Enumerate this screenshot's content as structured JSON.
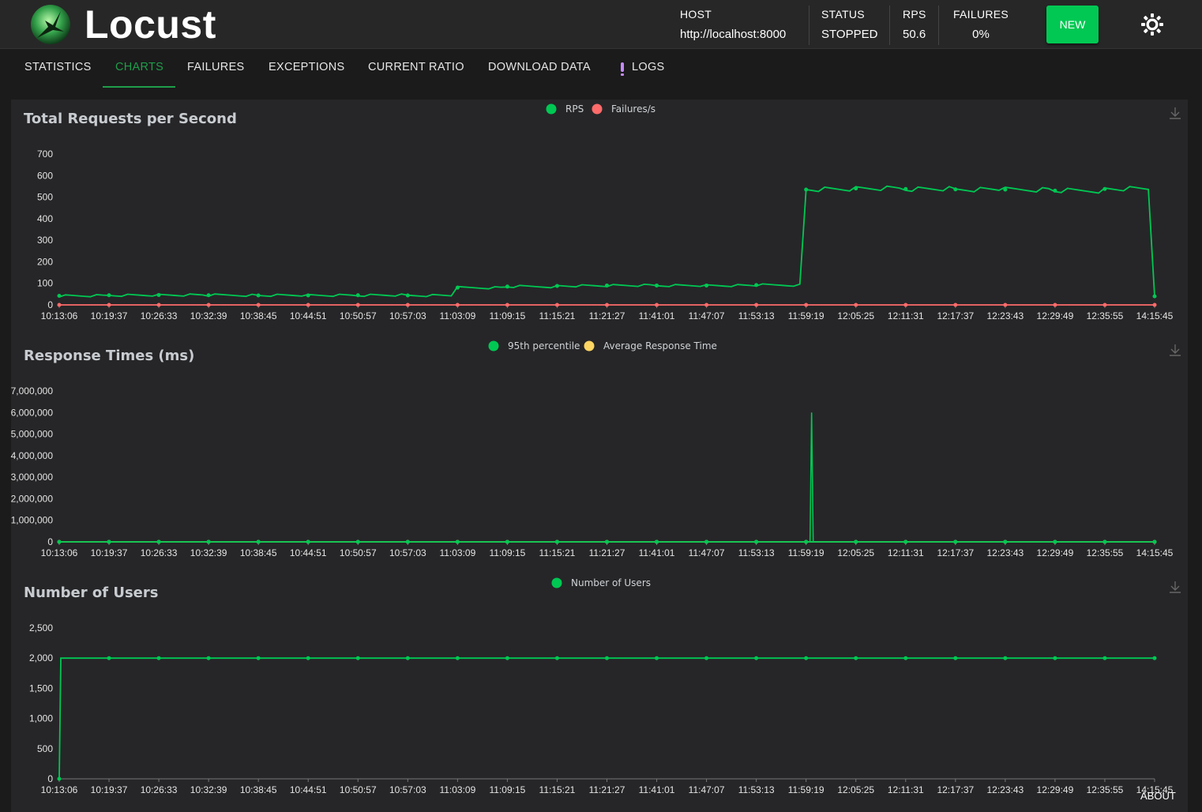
{
  "app": {
    "name": "Locust"
  },
  "header": {
    "host_label": "HOST",
    "host_value": "http://localhost:8000",
    "status_label": "STATUS",
    "status_value": "STOPPED",
    "rps_label": "RPS",
    "rps_value": "50.6",
    "failures_label": "FAILURES",
    "failures_value": "0%",
    "new_button": "NEW",
    "theme_icon": "sun-icon"
  },
  "tabs": [
    "STATISTICS",
    "CHARTS",
    "FAILURES",
    "EXCEPTIONS",
    "CURRENT RATIO",
    "DOWNLOAD DATA",
    "LOGS"
  ],
  "active_tab": "CHARTS",
  "footer": {
    "about": "ABOUT"
  },
  "colors": {
    "accent": "#00c853",
    "green": "#00c853",
    "red": "#ff6b6b",
    "yellow": "#fdd663",
    "tab_active": "#1e9e4a",
    "logs_alert": "#c58af9"
  },
  "chart_data": [
    {
      "type": "line",
      "title": "Total Requests per Second",
      "x": [
        "10:13:06",
        "10:19:37",
        "10:26:33",
        "10:32:39",
        "10:38:45",
        "10:44:51",
        "10:50:57",
        "10:57:03",
        "11:03:09",
        "11:09:15",
        "11:15:21",
        "11:21:27",
        "11:41:01",
        "11:47:07",
        "11:53:13",
        "11:59:19",
        "12:05:25",
        "12:11:31",
        "12:17:37",
        "12:23:43",
        "12:29:49",
        "12:35:55",
        "14:15:45"
      ],
      "ylim": [
        0,
        700
      ],
      "yticks": [
        "0",
        "100",
        "200",
        "300",
        "400",
        "500",
        "600",
        "700"
      ],
      "legend": "top-center",
      "series": [
        {
          "name": "RPS",
          "color": "#00c853",
          "values": [
            42,
            45,
            46,
            45,
            44,
            44,
            45,
            44,
            80,
            85,
            88,
            90,
            90,
            90,
            92,
            535,
            540,
            538,
            536,
            535,
            530,
            538,
            40
          ]
        },
        {
          "name": "Failures/s",
          "color": "#ff6b6b",
          "values": [
            0,
            0,
            0,
            0,
            0,
            0,
            0,
            0,
            0,
            0,
            0,
            0,
            0,
            0,
            0,
            0,
            0,
            0,
            0,
            0,
            0,
            0,
            0
          ]
        }
      ]
    },
    {
      "type": "line",
      "title": "Response Times (ms)",
      "x": [
        "10:13:06",
        "10:19:37",
        "10:26:33",
        "10:32:39",
        "10:38:45",
        "10:44:51",
        "10:50:57",
        "10:57:03",
        "11:03:09",
        "11:09:15",
        "11:15:21",
        "11:21:27",
        "11:41:01",
        "11:47:07",
        "11:53:13",
        "11:59:19",
        "12:05:25",
        "12:11:31",
        "12:17:37",
        "12:23:43",
        "12:29:49",
        "12:35:55",
        "14:15:45"
      ],
      "ylim": [
        0,
        7000000
      ],
      "yticks": [
        "0",
        "1,000,000",
        "2,000,000",
        "3,000,000",
        "4,000,000",
        "5,000,000",
        "6,000,000",
        "7,000,000"
      ],
      "legend": "top-center",
      "spike": {
        "x": "11:59:19",
        "value": 6000000
      },
      "series": [
        {
          "name": "95th percentile",
          "color": "#00c853",
          "values": [
            0,
            0,
            0,
            0,
            0,
            0,
            0,
            0,
            0,
            0,
            0,
            0,
            0,
            0,
            0,
            0,
            0,
            0,
            0,
            0,
            0,
            0,
            0
          ]
        },
        {
          "name": "Average Response Time",
          "color": "#fdd663",
          "values": [
            0,
            0,
            0,
            0,
            0,
            0,
            0,
            0,
            0,
            0,
            0,
            0,
            0,
            0,
            0,
            0,
            0,
            0,
            0,
            0,
            0,
            0,
            0
          ]
        }
      ]
    },
    {
      "type": "line",
      "title": "Number of Users",
      "x": [
        "10:13:06",
        "10:19:37",
        "10:26:33",
        "10:32:39",
        "10:38:45",
        "10:44:51",
        "10:50:57",
        "10:57:03",
        "11:03:09",
        "11:09:15",
        "11:15:21",
        "11:21:27",
        "11:41:01",
        "11:47:07",
        "11:53:13",
        "11:59:19",
        "12:05:25",
        "12:11:31",
        "12:17:37",
        "12:23:43",
        "12:29:49",
        "12:35:55",
        "14:15:45"
      ],
      "ylim": [
        0,
        2500
      ],
      "yticks": [
        "0",
        "500",
        "1,000",
        "1,500",
        "2,000",
        "2,500"
      ],
      "legend": "top-center",
      "series": [
        {
          "name": "Number of Users",
          "color": "#00c853",
          "values": [
            0,
            2000,
            2000,
            2000,
            2000,
            2000,
            2000,
            2000,
            2000,
            2000,
            2000,
            2000,
            2000,
            2000,
            2000,
            2000,
            2000,
            2000,
            2000,
            2000,
            2000,
            2000,
            2000
          ]
        }
      ]
    }
  ]
}
